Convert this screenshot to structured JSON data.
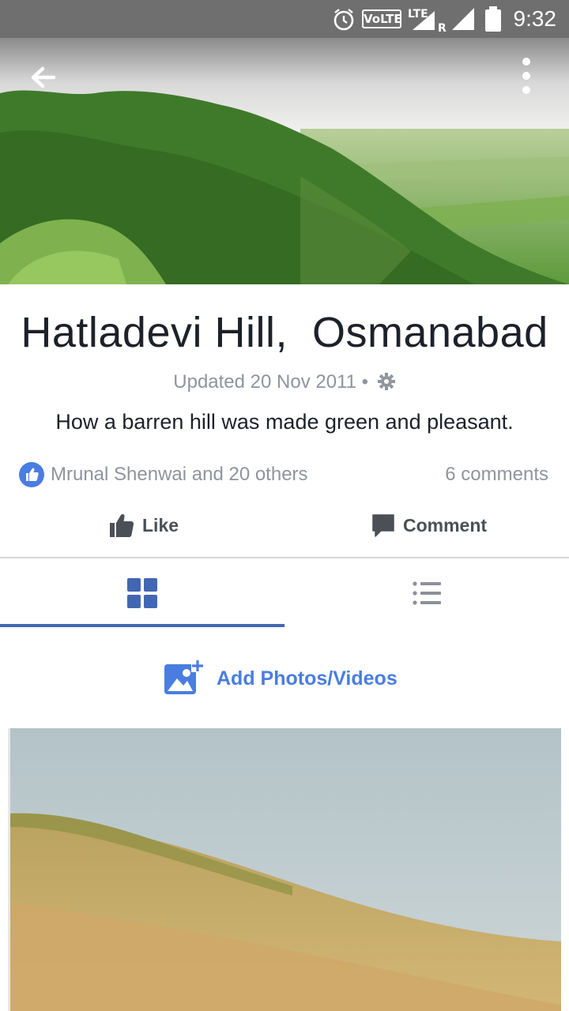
{
  "status_bar": {
    "time": "9:32",
    "volte": "VoLTE",
    "network": "LTE",
    "roaming": "R",
    "icons": [
      "alarm-icon",
      "volte-icon",
      "signal-icon",
      "signal-icon",
      "battery-icon"
    ]
  },
  "header": {
    "back_icon": "back-arrow-icon",
    "menu_icon": "more-vertical-icon"
  },
  "page": {
    "title": "Hatladevi Hill,  Osmanabad",
    "updated": "Updated 20 Nov 2011 •",
    "subtitle": "How a barren hill was made green and pleasant."
  },
  "reactions": {
    "reactors": "Mrunal Shenwai and 20 others",
    "comments": "6 comments"
  },
  "actions": {
    "like_label": "Like",
    "comment_label": "Comment"
  },
  "tabs": {
    "selected": "grid",
    "items": [
      "grid-icon",
      "list-icon"
    ]
  },
  "add_media": {
    "label": "Add Photos/Videos"
  },
  "colors": {
    "accent": "#4267b2",
    "link_blue": "#4a7de0",
    "muted_text": "#90949c",
    "status_bar": "#6f6f6f"
  }
}
